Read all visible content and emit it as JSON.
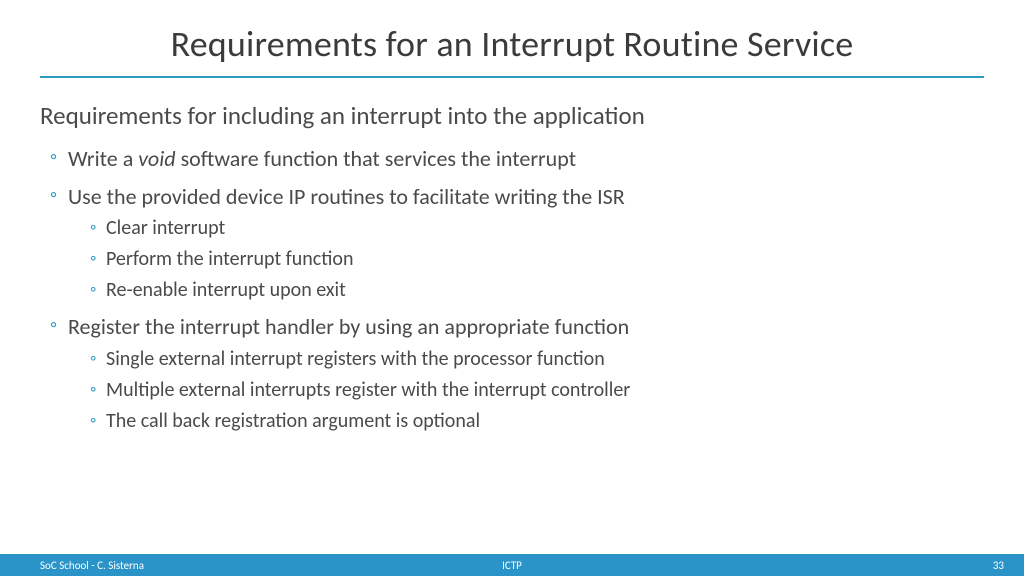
{
  "title": "Requirements for an Interrupt Routine Service",
  "lead": "Requirements for including an interrupt into the application",
  "bullets": [
    {
      "prefix": "Write a ",
      "emph": "void",
      "suffix": " software function that services the interrupt",
      "subs": []
    },
    {
      "text": "Use the provided device IP routines to facilitate writing the ISR",
      "subs": [
        "Clear interrupt",
        "Perform the interrupt function",
        "Re-enable interrupt upon exit"
      ]
    },
    {
      "text": "Register the interrupt handler by using an appropriate function",
      "subs": [
        "Single external interrupt registers with the processor function",
        "Multiple external interrupts register with the interrupt controller",
        "The call back registration argument is optional"
      ]
    }
  ],
  "footer": {
    "left": "SoC School - C. Sisterna",
    "center": "ICTP",
    "right": "33"
  }
}
